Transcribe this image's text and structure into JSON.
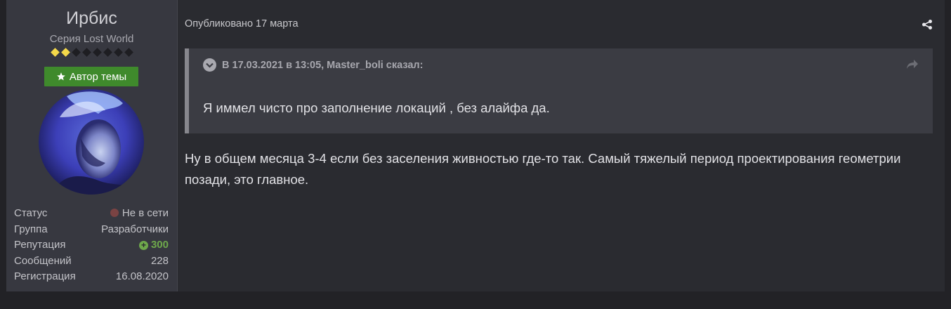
{
  "author": {
    "name": "Ирбис",
    "title": "Серия Lost World",
    "rank_pips_total": 8,
    "rank_pips_filled": 2,
    "badge_label": "Автор темы",
    "stats": [
      {
        "label": "Статус",
        "value": "Не в сети"
      },
      {
        "label": "Группа",
        "value": "Разработчики"
      },
      {
        "label": "Репутация",
        "value": "300"
      },
      {
        "label": "Сообщений",
        "value": "228"
      },
      {
        "label": "Регистрация",
        "value": "16.08.2020"
      }
    ]
  },
  "post": {
    "meta": "Опубликовано 17 марта",
    "quote": {
      "header": "В 17.03.2021 в 13:05, Master_boli сказал:",
      "text": "Я иммел чисто про заполнение локаций , без алайфа да."
    },
    "body": "Ну в общем месяца 3-4 если без заселения живностью где-то так. Самый тяжелый период проектирования геометрии позади, это главное."
  },
  "icons": {
    "share": "share-icon",
    "quote_toggle": "chevron-down-icon",
    "quote_goto": "arrow-forward-icon",
    "badge": "star-icon",
    "status": "offline-dot-icon",
    "reputation": "plus-circle-icon"
  },
  "colors": {
    "badge_bg": "#3f8a2c",
    "reputation": "#6ea84b",
    "pip_on": "#f5d94a"
  }
}
